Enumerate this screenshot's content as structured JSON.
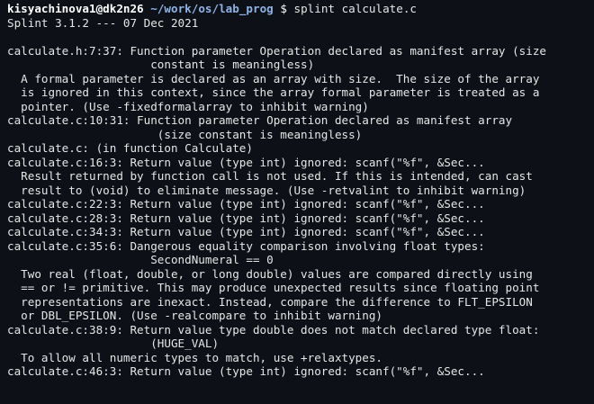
{
  "prompt": {
    "user_host": "kisyachinova1@dk2n26",
    "path": "~/work/os/lab_prog",
    "symbol": "$",
    "command": "splint calculate.c"
  },
  "output_lines": [
    "Splint 3.1.2 --- 07 Dec 2021",
    "",
    "calculate.h:7:37: Function parameter Operation declared as manifest array (size",
    "                     constant is meaningless)",
    "  A formal parameter is declared as an array with size.  The size of the array",
    "  is ignored in this context, since the array formal parameter is treated as a",
    "  pointer. (Use -fixedformalarray to inhibit warning)",
    "calculate.c:10:31: Function parameter Operation declared as manifest array",
    "                      (size constant is meaningless)",
    "calculate.c: (in function Calculate)",
    "calculate.c:16:3: Return value (type int) ignored: scanf(\"%f\", &Sec...",
    "  Result returned by function call is not used. If this is intended, can cast",
    "  result to (void) to eliminate message. (Use -retvalint to inhibit warning)",
    "calculate.c:22:3: Return value (type int) ignored: scanf(\"%f\", &Sec...",
    "calculate.c:28:3: Return value (type int) ignored: scanf(\"%f\", &Sec...",
    "calculate.c:34:3: Return value (type int) ignored: scanf(\"%f\", &Sec...",
    "calculate.c:35:6: Dangerous equality comparison involving float types:",
    "                     SecondNumeral == 0",
    "  Two real (float, double, or long double) values are compared directly using",
    "  == or != primitive. This may produce unexpected results since floating point",
    "  representations are inexact. Instead, compare the difference to FLT_EPSILON",
    "  or DBL_EPSILON. (Use -realcompare to inhibit warning)",
    "calculate.c:38:9: Return value type double does not match declared type float:",
    "                     (HUGE_VAL)",
    "  To allow all numeric types to match, use +relaxtypes.",
    "calculate.c:46:3: Return value (type int) ignored: scanf(\"%f\", &Sec..."
  ]
}
